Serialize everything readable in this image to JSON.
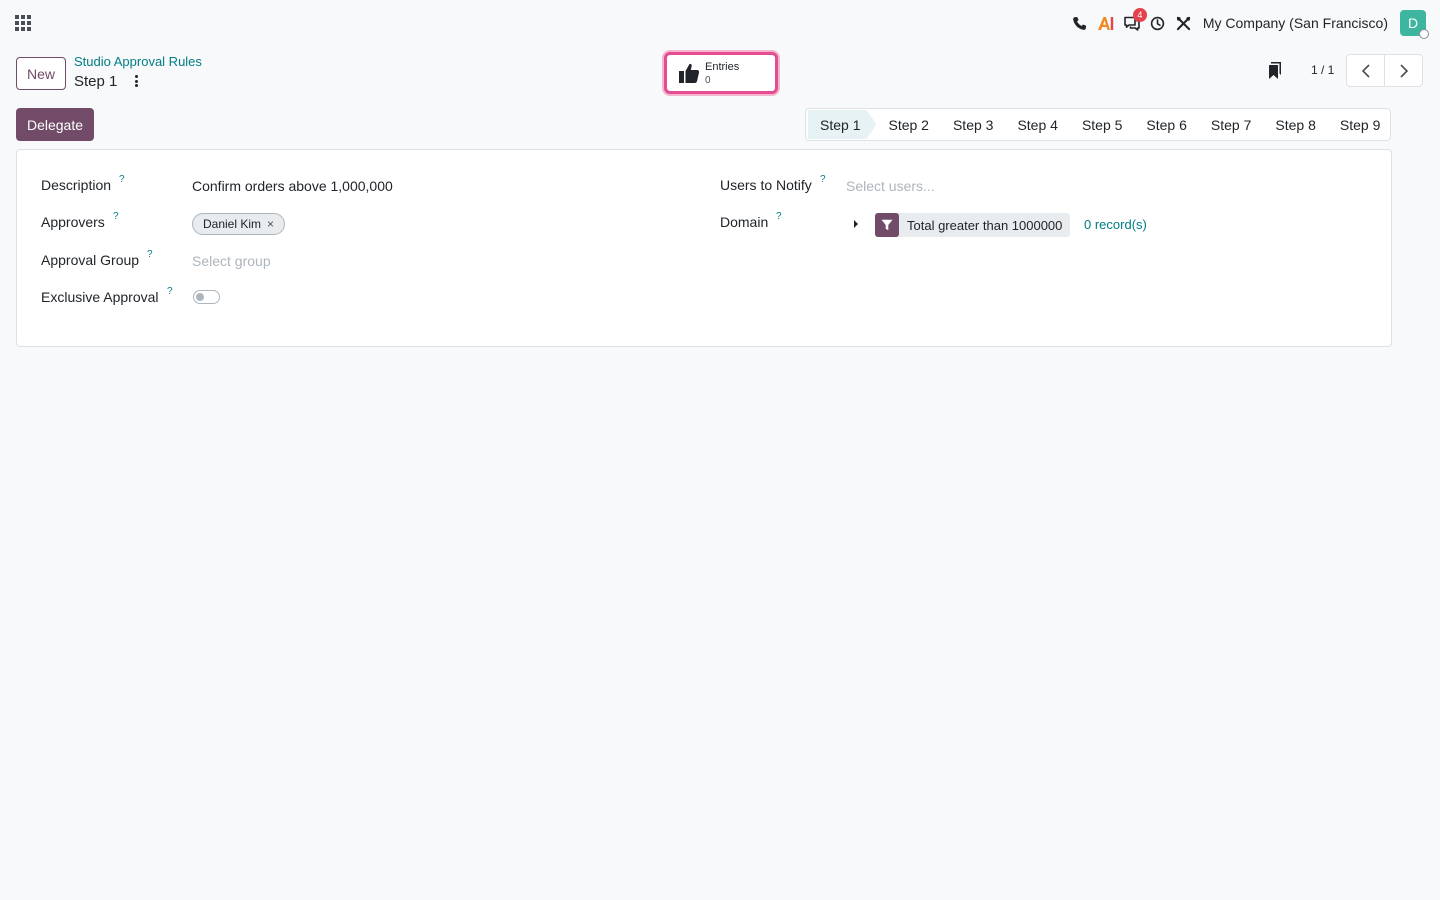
{
  "navbar": {
    "icons": [
      "apps-grid-icon",
      "phone-icon",
      "ai-icon",
      "discuss-icon",
      "clock-icon",
      "tools-icon"
    ],
    "messages_badge": "4",
    "company": "My Company (San Francisco)",
    "avatar_initial": "D"
  },
  "control_panel": {
    "new_label": "New",
    "breadcrumb_parent": "Studio Approval Rules",
    "breadcrumb_current": "Step 1",
    "smart_button": {
      "label": "Entries",
      "value": "0"
    },
    "pager": "1 / 1"
  },
  "actions": {
    "delegate_label": "Delegate"
  },
  "statusbar": {
    "steps": [
      "Step 1",
      "Step 2",
      "Step 3",
      "Step 4",
      "Step 5",
      "Step 6",
      "Step 7",
      "Step 8",
      "Step 9"
    ],
    "active": "Step 1"
  },
  "form": {
    "help_mark": "?",
    "description": {
      "label": "Description",
      "value": "Confirm orders above 1,000,000"
    },
    "approvers": {
      "label": "Approvers",
      "tags": [
        "Daniel Kim"
      ],
      "remove_glyph": "×"
    },
    "approval_group": {
      "label": "Approval Group",
      "placeholder": "Select group"
    },
    "exclusive_approval": {
      "label": "Exclusive Approval",
      "enabled": false
    },
    "users_to_notify": {
      "label": "Users to Notify",
      "placeholder": "Select users..."
    },
    "domain": {
      "label": "Domain",
      "rule": "Total greater than 1000000",
      "records": "0 record(s)"
    }
  },
  "colors": {
    "primary": "#714b67",
    "link": "#017e84",
    "highlight": "#e44d91",
    "avatar": "#3eb59e",
    "badge": "#e4424d"
  }
}
